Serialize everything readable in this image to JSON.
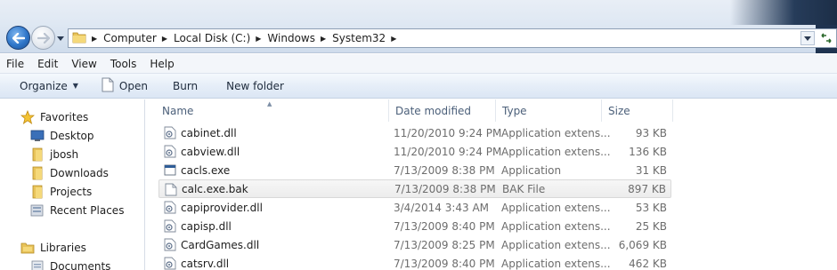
{
  "window": {
    "breadcrumb": [
      {
        "label": "Computer"
      },
      {
        "label": "Local Disk (C:)"
      },
      {
        "label": "Windows"
      },
      {
        "label": "System32"
      }
    ]
  },
  "menu": [
    "File",
    "Edit",
    "View",
    "Tools",
    "Help"
  ],
  "commands": {
    "organize": "Organize",
    "open": "Open",
    "burn": "Burn",
    "new_folder": "New folder"
  },
  "nav": {
    "favorites": {
      "label": "Favorites",
      "items": [
        {
          "label": "Desktop",
          "icon": "desktop-icon"
        },
        {
          "label": "jbosh",
          "icon": "folder-icon"
        },
        {
          "label": "Downloads",
          "icon": "folder-icon"
        },
        {
          "label": "Projects",
          "icon": "folder-icon"
        },
        {
          "label": "Recent Places",
          "icon": "recent-places-icon"
        }
      ]
    },
    "libraries": {
      "label": "Libraries",
      "items": [
        {
          "label": "Documents",
          "icon": "documents-library-icon"
        }
      ]
    }
  },
  "columns": {
    "name": "Name",
    "date": "Date modified",
    "type": "Type",
    "size": "Size"
  },
  "files": [
    {
      "name": "cabinet.dll",
      "date": "11/20/2010 9:24 PM",
      "type": "Application extens...",
      "size": "93 KB",
      "icon": "dll-icon"
    },
    {
      "name": "cabview.dll",
      "date": "11/20/2010 9:24 PM",
      "type": "Application extens...",
      "size": "136 KB",
      "icon": "dll-icon"
    },
    {
      "name": "cacls.exe",
      "date": "7/13/2009 8:38 PM",
      "type": "Application",
      "size": "31 KB",
      "icon": "exe-icon"
    },
    {
      "name": "calc.exe.bak",
      "date": "7/13/2009 8:38 PM",
      "type": "BAK File",
      "size": "897 KB",
      "icon": "blank-file-icon",
      "selected": true
    },
    {
      "name": "capiprovider.dll",
      "date": "3/4/2014 3:43 AM",
      "type": "Application extens...",
      "size": "53 KB",
      "icon": "dll-icon"
    },
    {
      "name": "capisp.dll",
      "date": "7/13/2009 8:40 PM",
      "type": "Application extens...",
      "size": "25 KB",
      "icon": "dll-icon"
    },
    {
      "name": "CardGames.dll",
      "date": "7/13/2009 8:25 PM",
      "type": "Application extens...",
      "size": "6,069 KB",
      "icon": "dll-icon"
    },
    {
      "name": "catsrv.dll",
      "date": "7/13/2009 8:40 PM",
      "type": "Application extens...",
      "size": "462 KB",
      "icon": "dll-icon"
    }
  ]
}
